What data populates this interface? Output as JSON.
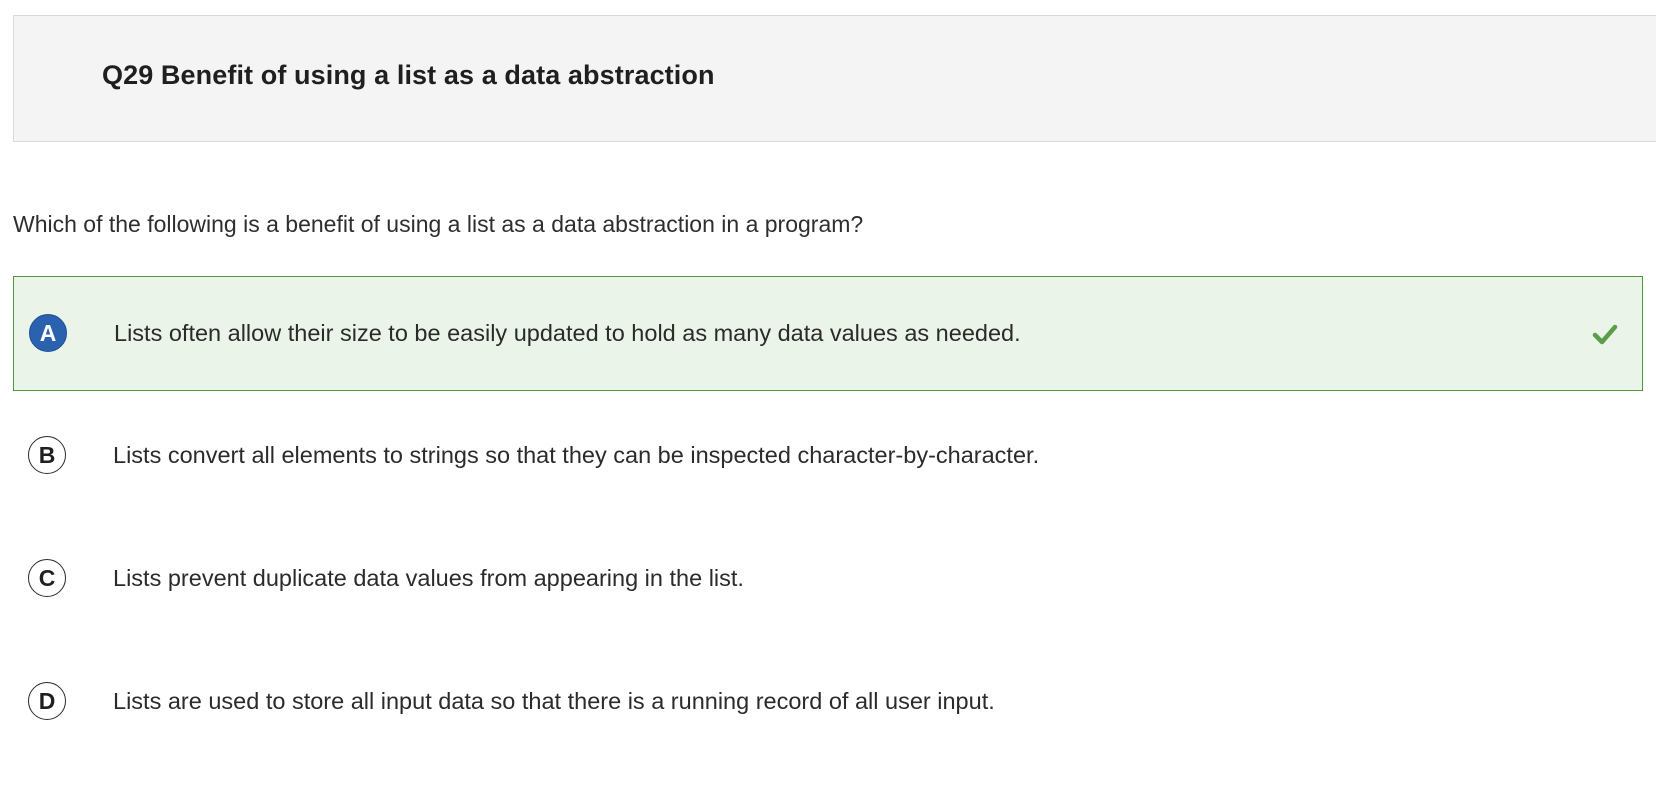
{
  "question": {
    "title": "Q29 Benefit of using a list as a data abstraction",
    "prompt": "Which of the following is a benefit of using a list as a data abstraction in a program?"
  },
  "choices": [
    {
      "letter": "A",
      "text": "Lists often allow their size to be easily updated to hold as many data values as needed.",
      "selected": true,
      "correct": true
    },
    {
      "letter": "B",
      "text": "Lists convert all elements to strings so that they can be inspected character-by-character.",
      "selected": false
    },
    {
      "letter": "C",
      "text": "Lists prevent duplicate data values from appearing in the list.",
      "selected": false
    },
    {
      "letter": "D",
      "text": "Lists are used to store all input data so that there is a running record of all user input.",
      "selected": false
    }
  ],
  "icons": {
    "correct": "check-icon"
  },
  "colors": {
    "selected_background": "#ebf4e8",
    "selected_border": "#4e9a3e",
    "selected_letter_fill": "#2a62b0",
    "check": "#5a9e47"
  }
}
